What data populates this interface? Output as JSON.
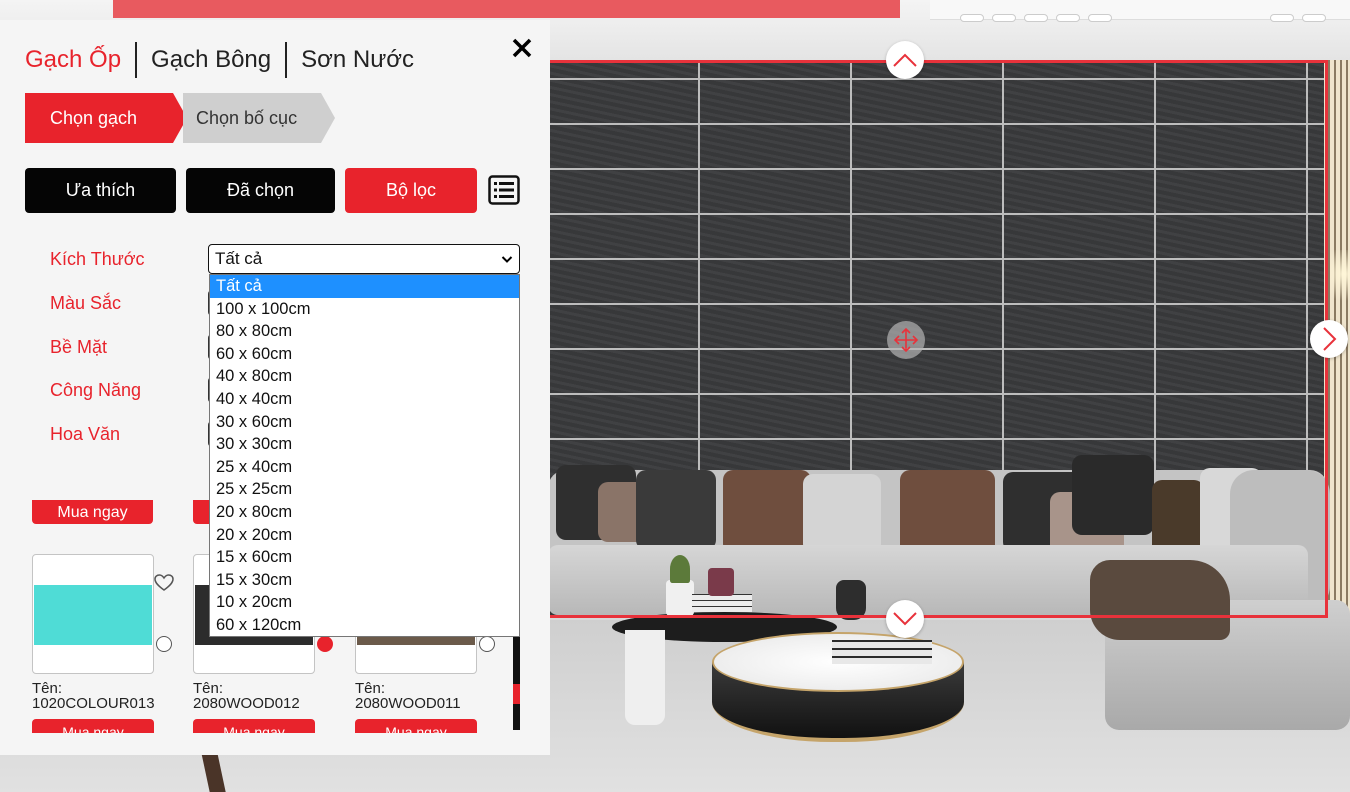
{
  "categories": {
    "tiles": "Gạch Ốp",
    "patterned": "Gạch Bông",
    "paint": "Sơn Nước"
  },
  "steps": {
    "choose_tile": "Chọn gạch",
    "choose_layout": "Chọn bố cục"
  },
  "actions": {
    "favorites": "Ưa thích",
    "selected": "Đã chọn",
    "filter": "Bộ lọc"
  },
  "filters": {
    "size_label": "Kích Thước",
    "color_label": "Màu Sắc",
    "surface_label": "Bề Mặt",
    "function_label": "Công Năng",
    "pattern_label": "Hoa Văn",
    "size_value": "Tất cả"
  },
  "size_options": [
    "Tất cả",
    "100 x 100cm",
    "80 x 80cm",
    "60 x 60cm",
    "40 x 80cm",
    "40 x 40cm",
    "30 x 60cm",
    "30 x 30cm",
    "25 x 40cm",
    "25 x 25cm",
    "20 x 80cm",
    "20 x 20cm",
    "15 x 60cm",
    "15 x 30cm",
    "10 x 20cm",
    "60 x 120cm"
  ],
  "buy_label": "Mua ngay",
  "products": [
    {
      "name_label": "Tên:",
      "code": "1020COLOUR013",
      "swatch_color": "#4fdcd6",
      "selected": false
    },
    {
      "name_label": "Tên:",
      "code": "2080WOOD012",
      "swatch_color": "#2c2c2c",
      "selected": true
    },
    {
      "name_label": "Tên:",
      "code": "2080WOOD011",
      "swatch_color": "#6b5a4a",
      "selected": false
    }
  ],
  "icons": {
    "close": "close-icon",
    "list": "list-icon",
    "heart": "heart-icon",
    "up": "chevron-up-icon",
    "down": "chevron-down-icon",
    "right": "chevron-right-icon",
    "move": "move-icon"
  },
  "colors": {
    "accent": "#e8232c",
    "dark": "#050505",
    "highlight": "#1e90ff"
  }
}
